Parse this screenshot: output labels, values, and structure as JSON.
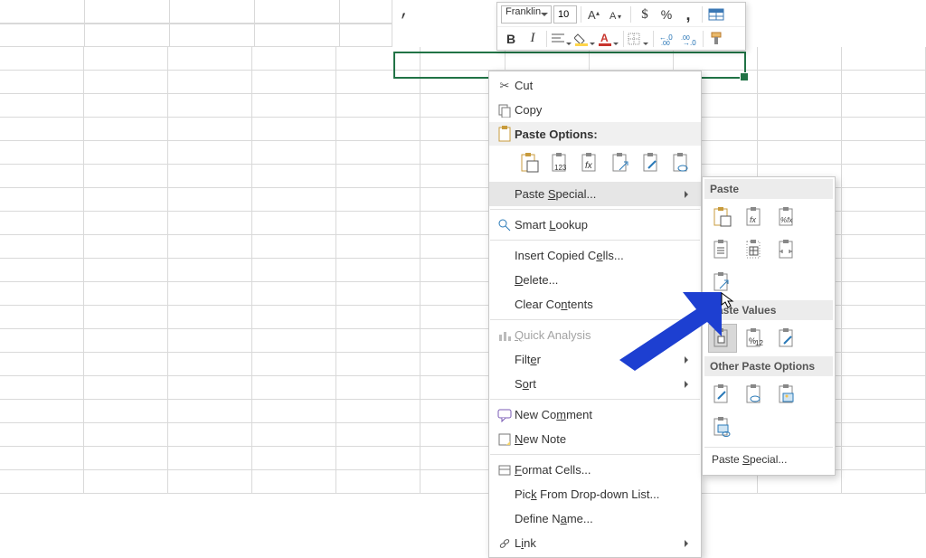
{
  "active_cell_value": ",",
  "mini_toolbar": {
    "font_name": "Franklin",
    "font_size": "10",
    "bold": "B",
    "italic": "I"
  },
  "context_menu": {
    "cut": "Cut",
    "copy": "Copy",
    "paste_options": "Paste Options:",
    "paste_special": "Paste Special...",
    "smart_lookup": "Smart Lookup",
    "insert_copied": "Insert Copied Cells...",
    "delete": "Delete...",
    "clear": "Clear Contents",
    "quick_analysis": "Quick Analysis",
    "filter": "Filter",
    "sort": "Sort",
    "new_comment": "New Comment",
    "new_note": "New Note",
    "format_cells": "Format Cells...",
    "pick_list": "Pick From Drop-down List...",
    "define_name": "Define Name...",
    "link": "Link"
  },
  "submenu": {
    "paste": "Paste",
    "paste_values": "Paste Values",
    "other": "Other Paste Options",
    "paste_special": "Paste Special..."
  }
}
